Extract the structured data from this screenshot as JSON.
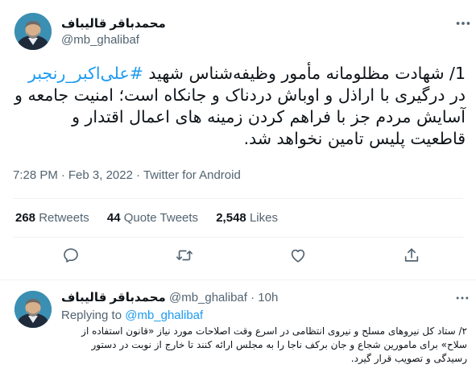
{
  "tweet": {
    "author_name": "محمدباقر قالیباف",
    "author_handle": "@mb_ghalibaf",
    "text_before_hashtag": "1/ شهادت مظلومانه مأمور وظیفه‌شناس شهید ",
    "hashtag": "#علی‌اکبر_رنجبر",
    "text_after_hashtag": " در درگیری با اراذل و اوباش دردناک و جانکاه است؛ امنیت جامعه و آسایش مردم جز با فراهم کردن زمینه های اعمال اقتدار و قاطعیت پلیس تامین نخواهد شد.",
    "time": "7:28 PM",
    "date": "Feb 3, 2022",
    "source": "Twitter for Android",
    "separator": "·"
  },
  "stats": {
    "retweets_count": "268",
    "retweets_label": "Retweets",
    "quotes_count": "44",
    "quotes_label": "Quote Tweets",
    "likes_count": "2,548",
    "likes_label": "Likes"
  },
  "actions": {
    "icons": [
      "reply-icon",
      "retweet-icon",
      "like-icon",
      "share-icon"
    ]
  },
  "reply": {
    "author_name": "محمدباقر قالیباف",
    "author_handle": "@mb_ghalibaf",
    "separator": "·",
    "time": "10h",
    "replying_to_label": "Replying to",
    "replying_to_handle": "@mb_ghalibaf",
    "text": "۲/ ستاد کل نیروهای مسلح و نیروی انتظامی در اسرع وقت اصلاحات مورد نیاز «قانون استفاده از سلاح» برای مامورین شجاع و جان برکف ناجا را به مجلس ارائه کنند تا خارج از نوبت در دستور رسیدگی و تصویب قرار گیرد."
  },
  "colors": {
    "accent": "#1d9bf0",
    "secondary_text": "#536471",
    "divider": "#eff3f4"
  }
}
